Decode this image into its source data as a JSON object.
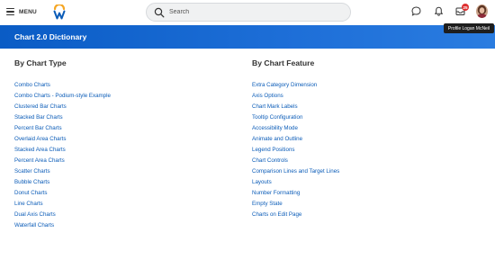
{
  "header": {
    "menu_label": "MENU",
    "search_placeholder": "Search",
    "inbox_badge": "25",
    "profile_tooltip": "Profile Logan McNeil"
  },
  "page": {
    "title": "Chart 2.0 Dictionary"
  },
  "left_column": {
    "heading": "By Chart Type",
    "links": [
      "Combo Charts",
      "Combo Charts - Podium-style Example",
      "Clustered Bar Charts",
      "Stacked Bar Charts",
      "Percent Bar Charts",
      "Overlaid Area Charts",
      "Stacked Area Charts",
      "Percent Area Charts",
      "Scatter Charts",
      "Bubble Charts",
      "Donut Charts",
      "Line Charts",
      "Dual Axis Charts",
      "Waterfall Charts"
    ]
  },
  "right_column": {
    "heading": "By Chart Feature",
    "links": [
      "Extra Category Dimension",
      "Axis Options",
      "Chart Mark Labels",
      "Tooltip Configuration",
      "Accessibility Mode",
      "Animate and Outline",
      "Legend Positions",
      "Chart Controls",
      "Comparison Lines and Target Lines",
      "Layouts",
      "Number Formatting",
      "Empty State",
      "Charts on Edit Page"
    ]
  },
  "colors": {
    "banner": "#0a5cc5",
    "link": "#0b5cb8",
    "badge": "#de2f2f"
  },
  "icons": [
    "menu-icon",
    "workday-logo",
    "search-icon",
    "chat-icon",
    "bell-icon",
    "inbox-icon",
    "avatar"
  ]
}
